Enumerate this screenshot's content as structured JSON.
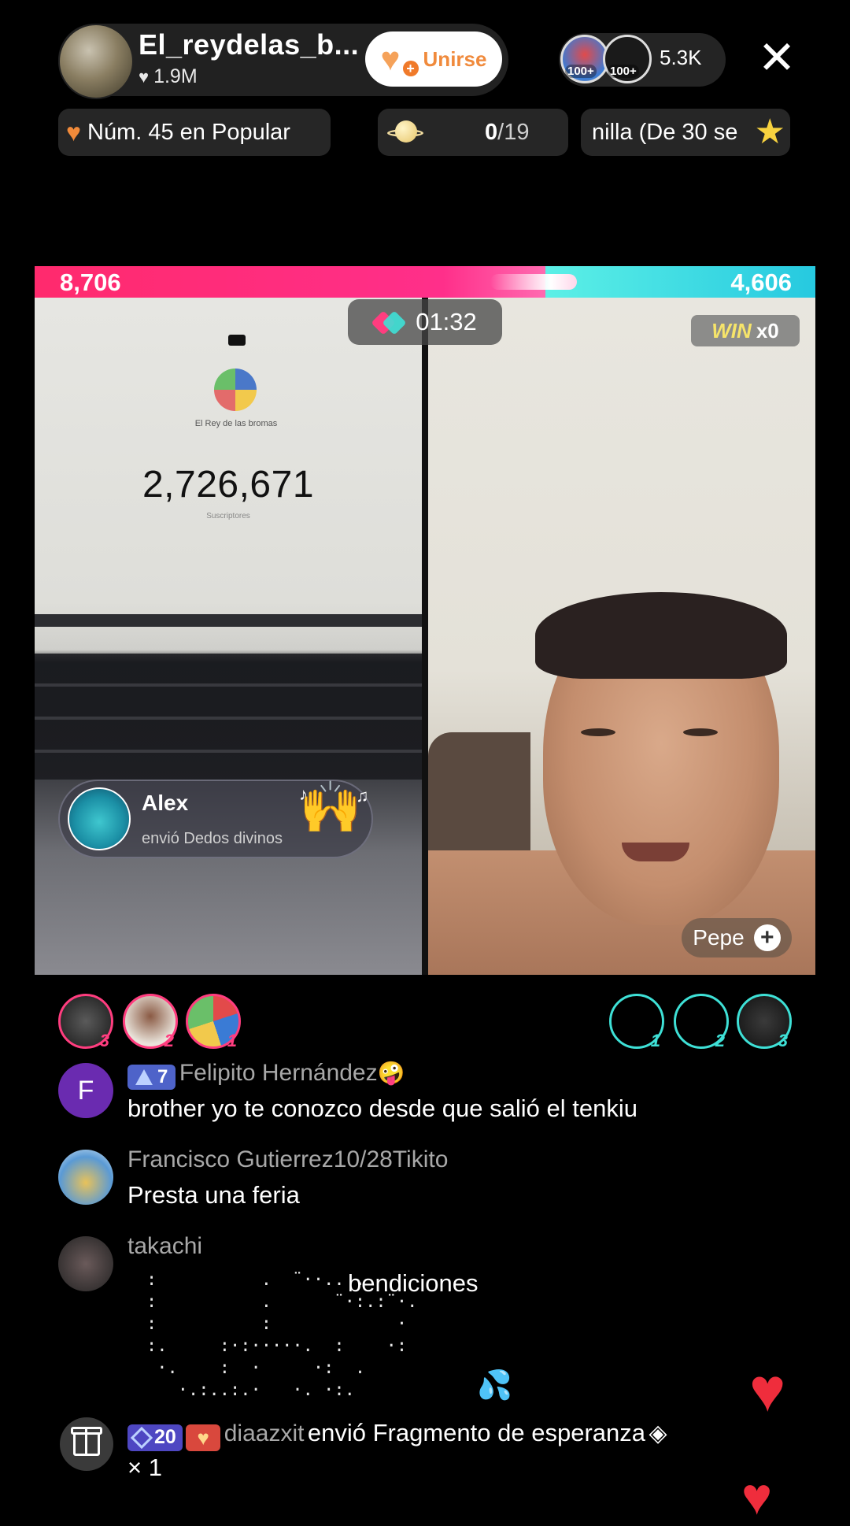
{
  "host": {
    "name": "El_reydelas_b...",
    "likes": "1.9M",
    "join_label": "Unirse"
  },
  "viewers": {
    "count": "5.3K",
    "avatar_badges": [
      "100+",
      "100+"
    ]
  },
  "chips": {
    "rank_text": "Núm. 45 en Popular",
    "goal_current": "0",
    "goal_total": "/19",
    "ticker_text": "nilla (De 30 se"
  },
  "battle": {
    "left_score": "8,706",
    "right_score": "4,606",
    "timer": "01:32",
    "win_label": "WIN",
    "win_count": "x0",
    "left_share": 0.654
  },
  "left_video": {
    "channel_name": "El Rey de las bromas",
    "subscriber_count": "2,726,671",
    "subscriber_label": "Suscriptores"
  },
  "gift_banner": {
    "sender": "Alex",
    "message": "envió Dedos divinos"
  },
  "right_video": {
    "guest_name": "Pepe"
  },
  "supporters": {
    "left_ranks": [
      "3",
      "2",
      "1"
    ],
    "right_ranks": [
      "1",
      "2",
      "3"
    ]
  },
  "comments": [
    {
      "initial": "F",
      "level": "7",
      "name": "Felipito Hernández",
      "emoji": "🤪",
      "text": "brother yo te conozco desde que salió el tenkiu"
    },
    {
      "name": "Francisco Gutierrez10/28Tikito",
      "text": "Presta una feria"
    },
    {
      "name": "takachi",
      "text": "bendiciones",
      "emoji": "💦"
    }
  ],
  "gift_event": {
    "level": "20",
    "user": "diaazxit",
    "message": "envió Fragmento de esperanza",
    "quantity": "× 1"
  },
  "colors": {
    "left_team": "#ff2f8a",
    "right_team": "#3ee0d6",
    "join_text": "#f08a3c"
  }
}
